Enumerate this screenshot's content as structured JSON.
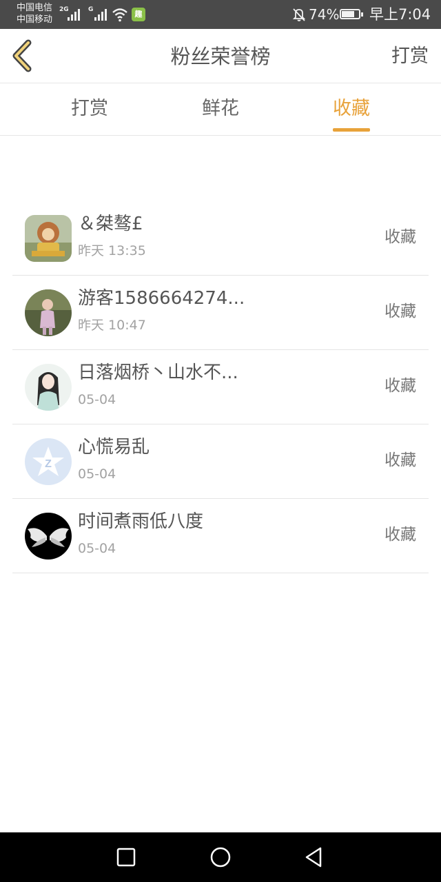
{
  "status_bar": {
    "carrier_1": "中国电信",
    "carrier_2": "中国移动",
    "network_1": "2G",
    "network_2": "G",
    "app_badge": "趣",
    "battery_percent": "74%",
    "battery_level": 0.74,
    "time": "早上7:04",
    "icons": [
      "signal-icon",
      "wifi-icon",
      "app-icon",
      "bell-off-icon",
      "battery-icon"
    ]
  },
  "header": {
    "title": "粉丝荣誉榜",
    "action": "打赏"
  },
  "tabs": [
    {
      "label": "打赏",
      "active": false
    },
    {
      "label": "鲜花",
      "active": false
    },
    {
      "label": "收藏",
      "active": true
    }
  ],
  "list": [
    {
      "name": "＆桀骜£",
      "time": "昨天 13:35",
      "action": "收藏"
    },
    {
      "name": "游客1586664274...",
      "time": "昨天 10:47",
      "action": "收藏"
    },
    {
      "name": "日落烟桥丶山水不...",
      "time": "05-04",
      "action": "收藏"
    },
    {
      "name": "心慌易乱",
      "time": "05-04",
      "action": "收藏"
    },
    {
      "name": "时间煮雨低八度",
      "time": "05-04",
      "action": "收藏"
    }
  ],
  "colors": {
    "accent": "#e8a23a",
    "status_bar": "#4a4a4a",
    "text": "#555555",
    "subtext": "#a2a2a2"
  },
  "nav_bar": {
    "icons": [
      "recent-apps-icon",
      "home-icon",
      "back-icon"
    ]
  }
}
